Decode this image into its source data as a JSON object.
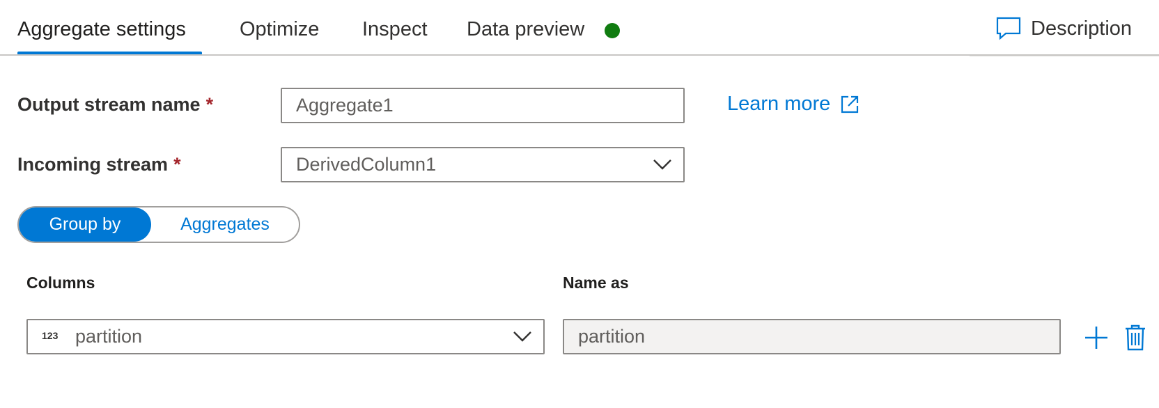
{
  "tabs": [
    {
      "label": "Aggregate settings",
      "active": true
    },
    {
      "label": "Optimize",
      "active": false
    },
    {
      "label": "Inspect",
      "active": false
    },
    {
      "label": "Data preview",
      "active": false,
      "status_color": "#107c10"
    }
  ],
  "description_button": {
    "label": "Description",
    "icon": "comment-icon"
  },
  "form": {
    "output_stream": {
      "label": "Output stream name",
      "required_mark": "*",
      "value": "Aggregate1"
    },
    "incoming_stream": {
      "label": "Incoming stream",
      "required_mark": "*",
      "value": "DerivedColumn1"
    },
    "learn_more": {
      "label": "Learn more",
      "icon": "external-link-icon"
    }
  },
  "toggle": {
    "selected": "Group by",
    "options": [
      "Group by",
      "Aggregates"
    ]
  },
  "group_by": {
    "headers": {
      "columns": "Columns",
      "name_as": "Name as"
    },
    "rows": [
      {
        "type_badge": "123",
        "column": "partition",
        "name_as": "partition"
      }
    ]
  },
  "colors": {
    "accent": "#0078d4",
    "required": "#a4262c",
    "status_ok": "#107c10"
  }
}
